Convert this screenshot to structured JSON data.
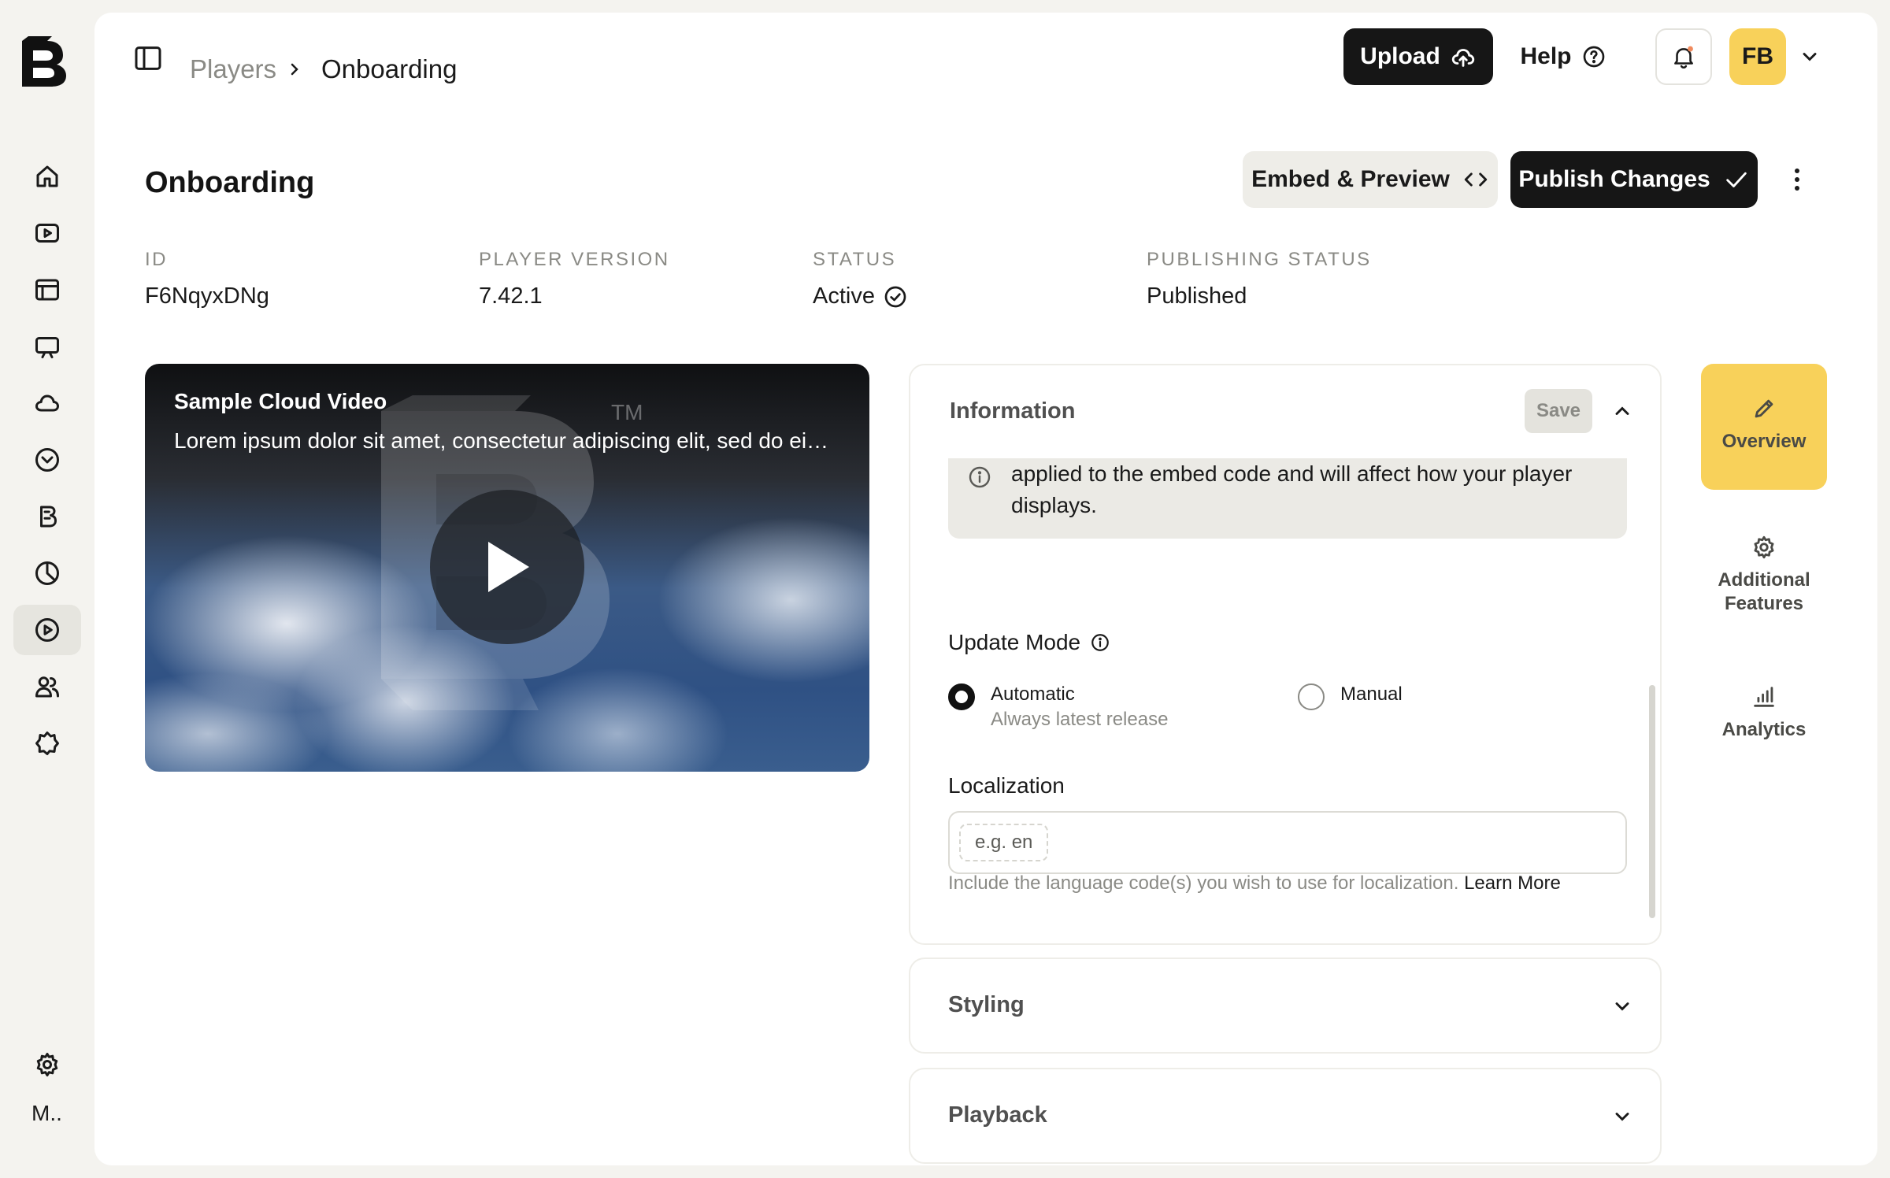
{
  "app": {
    "logo": "B"
  },
  "nav": {
    "items": [
      {
        "name": "home-icon"
      },
      {
        "name": "video-icon"
      },
      {
        "name": "layout-icon"
      },
      {
        "name": "screen-icon"
      },
      {
        "name": "cloud-icon"
      },
      {
        "name": "badge-icon"
      },
      {
        "name": "brand-icon"
      },
      {
        "name": "chart-icon"
      },
      {
        "name": "player-icon",
        "active": true
      },
      {
        "name": "users-icon"
      },
      {
        "name": "puzzle-icon"
      }
    ],
    "settings_icon": "gear-icon",
    "user_label": "M.."
  },
  "breadcrumb": {
    "parent": "Players",
    "current": "Onboarding"
  },
  "topbar": {
    "upload_label": "Upload",
    "help_label": "Help",
    "avatar_initials": "FB"
  },
  "page": {
    "title": "Onboarding",
    "embed_label": "Embed & Preview",
    "publish_label": "Publish Changes"
  },
  "meta": {
    "id_label": "ID",
    "id_value": "F6NqyxDNg",
    "version_label": "PLAYER VERSION",
    "version_value": "7.42.1",
    "status_label": "STATUS",
    "status_value": "Active",
    "publishing_label": "PUBLISHING STATUS",
    "publishing_value": "Published"
  },
  "video": {
    "title": "Sample Cloud Video",
    "description": "Lorem ipsum dolor sit amet, consectetur adipiscing elit, sed do ei…",
    "tm": "TM"
  },
  "information": {
    "title": "Information",
    "save_label": "Save",
    "info_text": "applied to the embed code and will affect how your player displays.",
    "update_mode_label": "Update Mode",
    "options": [
      {
        "label": "Automatic",
        "sub": "Always latest release",
        "selected": true
      },
      {
        "label": "Manual",
        "sub": "",
        "selected": false
      }
    ],
    "localization_label": "Localization",
    "localization_placeholder": "e.g. en",
    "localization_help": "Include the language code(s) you wish to use for localization.",
    "learn_more": "Learn More"
  },
  "sections": {
    "styling": "Styling",
    "playback": "Playback"
  },
  "right_tabs": {
    "overview": "Overview",
    "additional": "Additional Features",
    "analytics": "Analytics"
  },
  "colors": {
    "accent": "#f8d15a",
    "dark": "#161616",
    "background": "#f4f3ef"
  }
}
